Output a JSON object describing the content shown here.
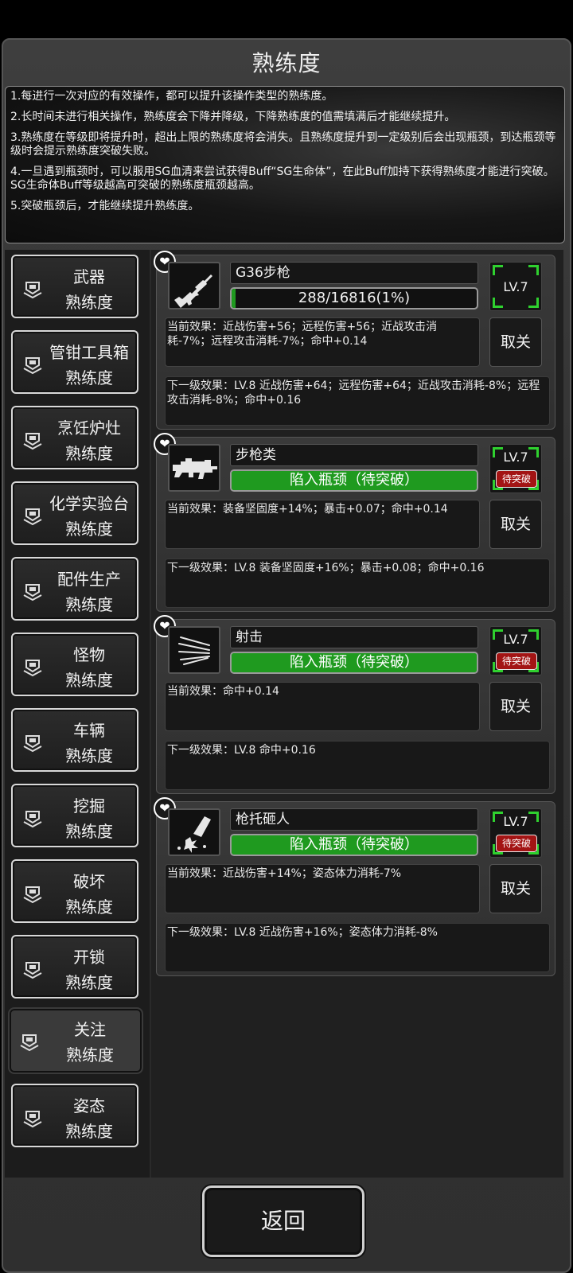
{
  "title": "熟练度",
  "notes": [
    "1.每进行一次对应的有效操作，都可以提升该操作类型的熟练度。",
    "2.长时间未进行相关操作，熟练度会下降并降级，下降熟练度的值需填满后才能继续提升。",
    "3.熟练度在等级即将提升时，超出上限的熟练度将会消失。且熟练度提升到一定级别后会出现瓶颈，到达瓶颈等级时会提示熟练度突破失败。",
    "4.一旦遇到瓶颈时，可以服用SG血清来尝试获得Buff“SG生命体”，在此Buff加持下获得熟练度才能进行突破。SG生命体Buff等级越高可突破的熟练度瓶颈越高。",
    "5.突破瓶颈后，才能继续提升熟练度。"
  ],
  "categories": [
    {
      "name": "武器",
      "sub": "熟练度"
    },
    {
      "name": "管钳工具箱",
      "sub": "熟练度"
    },
    {
      "name": "烹饪炉灶",
      "sub": "熟练度"
    },
    {
      "name": "化学实验台",
      "sub": "熟练度"
    },
    {
      "name": "配件生产",
      "sub": "熟练度"
    },
    {
      "name": "怪物",
      "sub": "熟练度"
    },
    {
      "name": "车辆",
      "sub": "熟练度"
    },
    {
      "name": "挖掘",
      "sub": "熟练度"
    },
    {
      "name": "破坏",
      "sub": "熟练度"
    },
    {
      "name": "开锁",
      "sub": "熟练度"
    },
    {
      "name": "关注",
      "sub": "熟练度",
      "active": true
    },
    {
      "name": "姿态",
      "sub": "熟练度"
    }
  ],
  "skills": [
    {
      "name": "G36步枪",
      "icon": "rifle-icon",
      "progress_text": "288/16816(1%)",
      "progress_fraction": 0.017,
      "level": "LV.7",
      "breakthrough": "",
      "current_effect": "当前效果：近战伤害+56；远程伤害+56；近战攻击消耗-7%；远程攻击消耗-7%；命中+0.14",
      "cancel_label": "取关",
      "next_effect": "下一级效果：LV.8 近战伤害+64；远程伤害+64；近战攻击消耗-8%；远程攻击消耗-8%；命中+0.16"
    },
    {
      "name": "步枪类",
      "icon": "assault-rifle-icon",
      "progress_text": "陷入瓶颈（待突破）",
      "progress_fraction": 1,
      "level": "LV.7",
      "breakthrough": "待突破",
      "current_effect": "当前效果：装备坚固度+14%；暴击+0.07；命中+0.14",
      "cancel_label": "取关",
      "next_effect": "下一级效果：LV.8 装备坚固度+16%；暴击+0.08；命中+0.16"
    },
    {
      "name": "射击",
      "icon": "shooting-icon",
      "progress_text": "陷入瓶颈（待突破）",
      "progress_fraction": 1,
      "level": "LV.7",
      "breakthrough": "待突破",
      "current_effect": "当前效果：命中+0.14",
      "cancel_label": "取关",
      "next_effect": "下一级效果：LV.8 命中+0.16"
    },
    {
      "name": "枪托砸人",
      "icon": "rifle-butt-smash-icon",
      "progress_text": "陷入瓶颈（待突破）",
      "progress_fraction": 1,
      "level": "LV.7",
      "breakthrough": "待突破",
      "current_effect": "当前效果：近战伤害+14%；姿态体力消耗-7%",
      "cancel_label": "取关",
      "next_effect": "下一级效果：LV.8 近战伤害+16%；姿态体力消耗-8%"
    }
  ],
  "back_label": "返回",
  "colors": {
    "progress_green": "#1f9a1f",
    "breakthrough_red": "#a31414",
    "level_corner": "#2fd12f"
  }
}
